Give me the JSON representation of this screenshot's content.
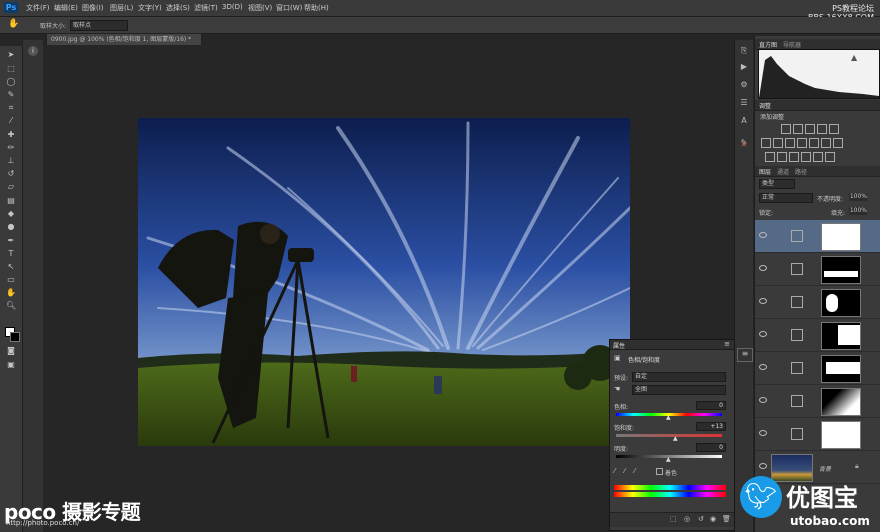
{
  "app": {
    "logo": "Ps",
    "menus": [
      "文件(F)",
      "编辑(E)",
      "图像(I)",
      "图层(L)",
      "文字(Y)",
      "选择(S)",
      "滤镜(T)",
      "3D(D)",
      "视图(V)",
      "窗口(W)",
      "帮助(H)"
    ],
    "window_controls": "– ▢ ✕"
  },
  "watermark_top": {
    "line1": "PS教程论坛",
    "line2": "BBS.16XX8.COM"
  },
  "options_bar": {
    "label": "取样大小:",
    "value": "取样点"
  },
  "document": {
    "tab_title": "0900.jpg @ 100% (色相/饱和度 1, 图层蒙版/16) *"
  },
  "panels": {
    "histogram_tabs": [
      "直方图",
      "导航器"
    ],
    "adjust_tabs": [
      "调整"
    ],
    "adjust_title": "添加调整",
    "layers_tabs": [
      "图层",
      "通道",
      "路径"
    ],
    "kind_label": "类型",
    "blend_mode": "正常",
    "opacity_label": "不透明度:",
    "opacity_value": "100%",
    "lock_label": "锁定:",
    "fill_label": "填充:",
    "fill_value": "100%",
    "background_layer": "背景"
  },
  "properties": {
    "tab": "属性",
    "title": "色相/饱和度",
    "preset_label": "预设:",
    "preset_value": "自定",
    "channel_value": "全图",
    "hue_label": "色相:",
    "hue_value": "0",
    "sat_label": "饱和度:",
    "sat_value": "+13",
    "light_label": "明度:",
    "light_value": "0",
    "colorize_label": "着色"
  },
  "bottom_watermark": {
    "brand": "poco 摄影专题",
    "url": "http://photo.poco.cn/"
  },
  "logo_watermark": {
    "name": "优图宝",
    "url": "utobao.com"
  }
}
